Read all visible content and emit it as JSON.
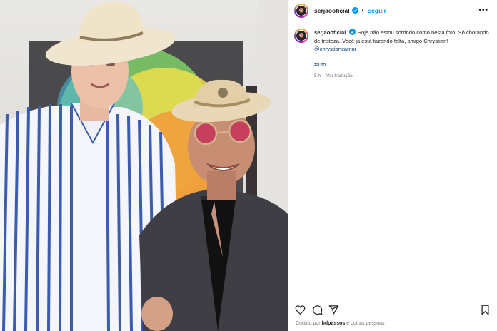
{
  "post": {
    "username": "serjaooficial",
    "follow_label": "Seguir",
    "separator": "•",
    "more_label": "•••",
    "caption_line1": "Hoje não estou sorrindo como nesta foto. Só chorando de tristeza. Você já está fazendo falta, amigo Chrystian!",
    "mention": "@chrystiancantor",
    "hashtag": "#luto",
    "time": "5 h",
    "translate_label": "Ver tradução"
  },
  "likes": {
    "prefix": "Curtido por",
    "user": "bdpassos",
    "suffix": "e outras pessoas"
  },
  "icons": {
    "verified": "verified-badge-icon",
    "like": "heart-icon",
    "comment": "comment-icon",
    "share": "send-icon",
    "save": "bookmark-icon"
  },
  "colors": {
    "accent": "#0095f6",
    "verified": "#0095f6",
    "link": "#00376b",
    "muted": "#737373"
  }
}
